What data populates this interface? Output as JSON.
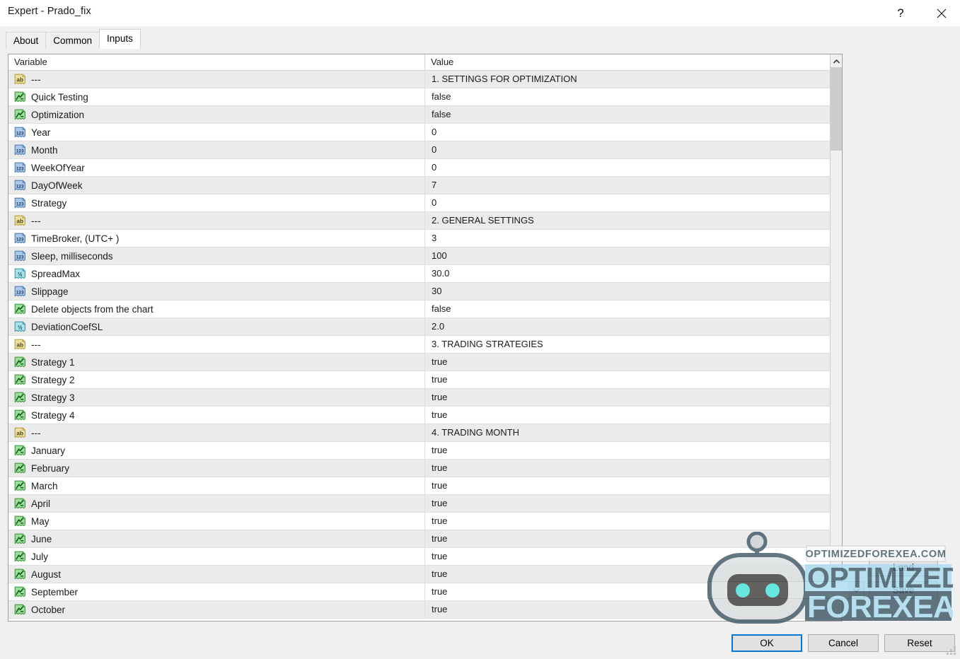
{
  "window": {
    "title": "Expert - Prado_fix",
    "help_icon": "?",
    "close_icon": "close-icon"
  },
  "tabs": [
    {
      "label": "About",
      "active": false
    },
    {
      "label": "Common",
      "active": false
    },
    {
      "label": "Inputs",
      "active": true
    }
  ],
  "table": {
    "headers": {
      "variable": "Variable",
      "value": "Value"
    },
    "rows": [
      {
        "icon": "string-icon",
        "name": "---",
        "value": "1. SETTINGS FOR OPTIMIZATION"
      },
      {
        "icon": "bool-icon",
        "name": "Quick Testing",
        "value": "false"
      },
      {
        "icon": "bool-icon",
        "name": "Optimization",
        "value": "false"
      },
      {
        "icon": "int-icon",
        "name": "Year",
        "value": "0"
      },
      {
        "icon": "int-icon",
        "name": "Month",
        "value": "0"
      },
      {
        "icon": "int-icon",
        "name": "WeekOfYear",
        "value": "0"
      },
      {
        "icon": "int-icon",
        "name": "DayOfWeek",
        "value": "7"
      },
      {
        "icon": "int-icon",
        "name": "Strategy",
        "value": "0"
      },
      {
        "icon": "string-icon",
        "name": "---",
        "value": "2. GENERAL SETTINGS"
      },
      {
        "icon": "int-icon",
        "name": "TimeBroker, (UTC+ )",
        "value": "3"
      },
      {
        "icon": "int-icon",
        "name": "Sleep, milliseconds",
        "value": "100"
      },
      {
        "icon": "double-icon",
        "name": "SpreadMax",
        "value": "30.0"
      },
      {
        "icon": "int-icon",
        "name": "Slippage",
        "value": "30"
      },
      {
        "icon": "bool-icon",
        "name": "Delete objects from the chart",
        "value": "false"
      },
      {
        "icon": "double-icon",
        "name": "DeviationCoefSL",
        "value": "2.0"
      },
      {
        "icon": "string-icon",
        "name": "---",
        "value": "3. TRADING STRATEGIES"
      },
      {
        "icon": "bool-icon",
        "name": "Strategy 1",
        "value": "true"
      },
      {
        "icon": "bool-icon",
        "name": "Strategy 2",
        "value": "true"
      },
      {
        "icon": "bool-icon",
        "name": "Strategy 3",
        "value": "true"
      },
      {
        "icon": "bool-icon",
        "name": "Strategy 4",
        "value": "true"
      },
      {
        "icon": "string-icon",
        "name": "---",
        "value": "4. TRADING MONTH"
      },
      {
        "icon": "bool-icon",
        "name": "January",
        "value": "true"
      },
      {
        "icon": "bool-icon",
        "name": "February",
        "value": "true"
      },
      {
        "icon": "bool-icon",
        "name": "March",
        "value": "true"
      },
      {
        "icon": "bool-icon",
        "name": "April",
        "value": "true"
      },
      {
        "icon": "bool-icon",
        "name": "May",
        "value": "true"
      },
      {
        "icon": "bool-icon",
        "name": "June",
        "value": "true"
      },
      {
        "icon": "bool-icon",
        "name": "July",
        "value": "true"
      },
      {
        "icon": "bool-icon",
        "name": "August",
        "value": "true"
      },
      {
        "icon": "bool-icon",
        "name": "September",
        "value": "true"
      },
      {
        "icon": "bool-icon",
        "name": "October",
        "value": "true"
      }
    ]
  },
  "scrollbar": {
    "up_arrow": "chevron-up-icon"
  },
  "buttons": {
    "ok": "OK",
    "cancel": "Cancel",
    "reset": "Reset",
    "load": "Load",
    "save": "Save"
  },
  "watermark": {
    "site": "OPTIMIZEDFOREXEA.COM",
    "line1": "OPTIMIZED",
    "line2": "FOREXEA"
  },
  "colors": {
    "focus_blue": "#0078d7",
    "icon_string": "#e8d98a",
    "icon_bool": "#8fe08f",
    "icon_int": "#8fb9e8",
    "icon_double": "#9fe0e8",
    "row_alt": "#ebebeb",
    "logo_dark": "#3c5663",
    "logo_light": "#a8dcf0",
    "robot_eye": "#3fe0d8"
  }
}
